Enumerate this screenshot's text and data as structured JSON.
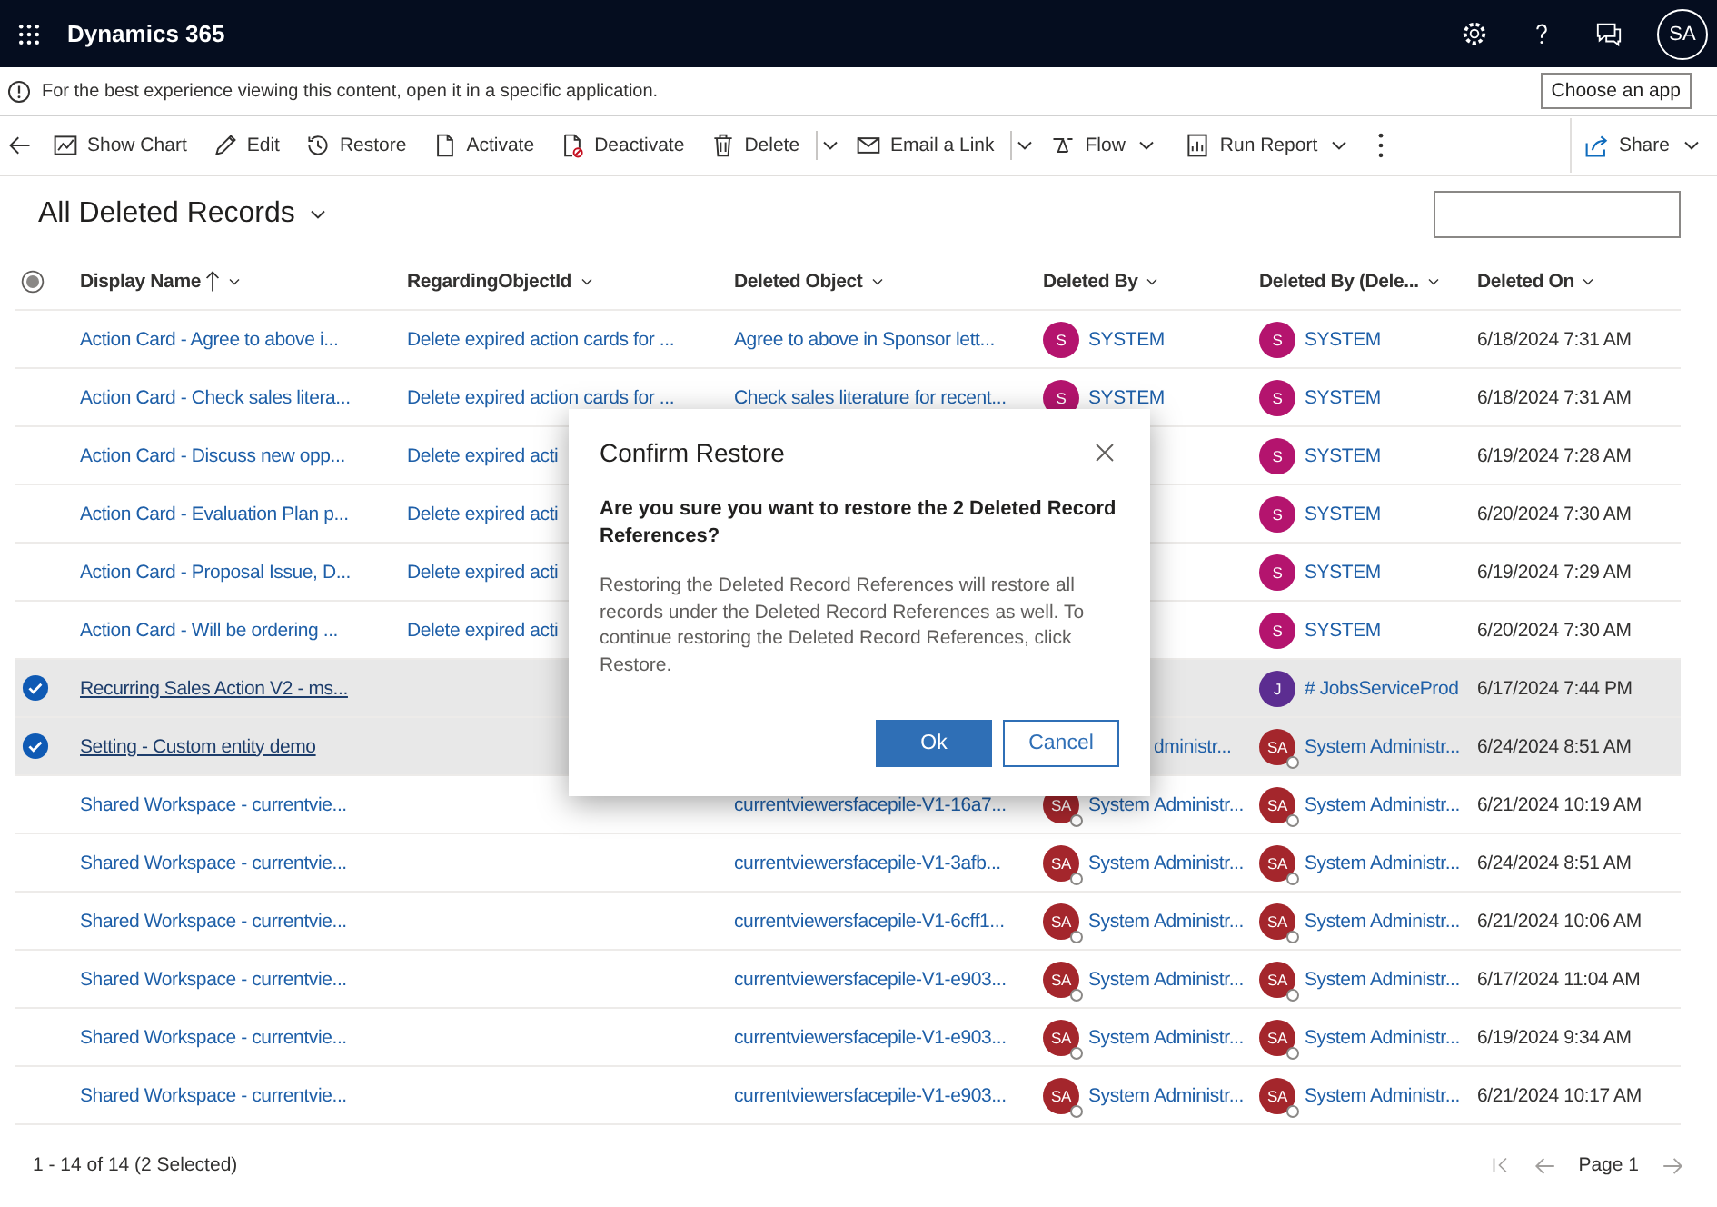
{
  "app": {
    "title": "Dynamics 365",
    "user_initials": "SA"
  },
  "notice": {
    "text": "For the best experience viewing this content, open it in a specific application.",
    "button": "Choose an app"
  },
  "commands": [
    {
      "label": "Show Chart",
      "kind": "button"
    },
    {
      "label": "Edit",
      "kind": "button"
    },
    {
      "label": "Restore",
      "kind": "button"
    },
    {
      "label": "Activate",
      "kind": "button"
    },
    {
      "label": "Deactivate",
      "kind": "button"
    },
    {
      "label": "Delete",
      "kind": "split"
    },
    {
      "label": "Email a Link",
      "kind": "split"
    },
    {
      "label": "Flow",
      "kind": "menu"
    },
    {
      "label": "Run Report",
      "kind": "menu"
    },
    {
      "kind": "overflow"
    },
    {
      "label": "Share",
      "kind": "menu"
    }
  ],
  "view": {
    "title": "All Deleted Records"
  },
  "columns": [
    {
      "label": "Display Name",
      "sorted_ascending": true
    },
    {
      "label": "RegardingObjectId",
      "sorted_ascending": false
    },
    {
      "label": "Deleted Object",
      "sorted_ascending": false
    },
    {
      "label": "Deleted By",
      "sorted_ascending": false
    },
    {
      "label": "Deleted By (Dele...",
      "sorted_ascending": false
    },
    {
      "label": "Deleted On",
      "sorted_ascending": false
    }
  ],
  "select_all": {
    "partial": true
  },
  "rows": [
    {
      "selected": false,
      "display_name": "Action Card - Agree to above i...",
      "regarding": "Delete expired action cards for ...",
      "deleted_object": "Agree to above in Sponsor lett...",
      "deleted_by": {
        "initials": "S",
        "name": "SYSTEM",
        "color": "#b4146e",
        "status_badge": false
      },
      "deleted_by_user": {
        "initials": "S",
        "name": "SYSTEM",
        "color": "#b4146e",
        "status_badge": false
      },
      "deleted_on": "6/18/2024 7:31 AM"
    },
    {
      "selected": false,
      "display_name": "Action Card - Check sales litera...",
      "regarding": "Delete expired action cards for ...",
      "deleted_object": "Check sales literature for recent...",
      "deleted_by": {
        "initials": "S",
        "name": "SYSTEM",
        "color": "#b4146e",
        "status_badge": false
      },
      "deleted_by_user": {
        "initials": "S",
        "name": "SYSTEM",
        "color": "#b4146e",
        "status_badge": false
      },
      "deleted_on": "6/18/2024 7:31 AM"
    },
    {
      "selected": false,
      "display_name": "Action Card - Discuss new opp...",
      "regarding": "Delete expired acti",
      "deleted_by_user": {
        "initials": "S",
        "name": "SYSTEM",
        "color": "#b4146e",
        "status_badge": false
      },
      "deleted_on": "6/19/2024 7:28 AM"
    },
    {
      "selected": false,
      "display_name": "Action Card - Evaluation Plan p...",
      "regarding": "Delete expired acti",
      "deleted_by_user": {
        "initials": "S",
        "name": "SYSTEM",
        "color": "#b4146e",
        "status_badge": false
      },
      "deleted_on": "6/20/2024 7:30 AM"
    },
    {
      "selected": false,
      "display_name": "Action Card - Proposal Issue, D...",
      "regarding": "Delete expired acti",
      "deleted_by_user": {
        "initials": "S",
        "name": "SYSTEM",
        "color": "#b4146e",
        "status_badge": false
      },
      "deleted_on": "6/19/2024 7:29 AM"
    },
    {
      "selected": false,
      "display_name": "Action Card - Will be ordering ...",
      "regarding": "Delete expired acti",
      "deleted_by_user": {
        "initials": "S",
        "name": "SYSTEM",
        "color": "#b4146e",
        "status_badge": false
      },
      "deleted_on": "6/20/2024 7:30 AM"
    },
    {
      "selected": true,
      "display_name": "Recurring Sales Action V2 - ms...",
      "deleted_by_user": {
        "initials": "J",
        "name": "# JobsServiceProd",
        "color": "#5c2d91",
        "status_badge": false
      },
      "deleted_on": "6/17/2024 7:44 PM"
    },
    {
      "selected": true,
      "display_name": "Setting - Custom entity demo",
      "deleted_by": {
        "name": "dministr..."
      },
      "deleted_by_user": {
        "initials": "SA",
        "name": "System Administr...",
        "color": "#a4262c",
        "status_badge": true
      },
      "deleted_on": "6/24/2024 8:51 AM"
    },
    {
      "selected": false,
      "display_name": "Shared Workspace - currentvie...",
      "deleted_object": "currentviewersfacepile-V1-16a7...",
      "deleted_by": {
        "initials": "SA",
        "name": "System Administr...",
        "color": "#a4262c",
        "status_badge": true
      },
      "deleted_by_user": {
        "initials": "SA",
        "name": "System Administr...",
        "color": "#a4262c",
        "status_badge": true
      },
      "deleted_on": "6/21/2024 10:19 AM"
    },
    {
      "selected": false,
      "display_name": "Shared Workspace - currentvie...",
      "deleted_object": "currentviewersfacepile-V1-3afb...",
      "deleted_by": {
        "initials": "SA",
        "name": "System Administr...",
        "color": "#a4262c",
        "status_badge": true
      },
      "deleted_by_user": {
        "initials": "SA",
        "name": "System Administr...",
        "color": "#a4262c",
        "status_badge": true
      },
      "deleted_on": "6/24/2024 8:51 AM"
    },
    {
      "selected": false,
      "display_name": "Shared Workspace - currentvie...",
      "deleted_object": "currentviewersfacepile-V1-6cff1...",
      "deleted_by": {
        "initials": "SA",
        "name": "System Administr...",
        "color": "#a4262c",
        "status_badge": true
      },
      "deleted_by_user": {
        "initials": "SA",
        "name": "System Administr...",
        "color": "#a4262c",
        "status_badge": true
      },
      "deleted_on": "6/21/2024 10:06 AM"
    },
    {
      "selected": false,
      "display_name": "Shared Workspace - currentvie...",
      "deleted_object": "currentviewersfacepile-V1-e903...",
      "deleted_by": {
        "initials": "SA",
        "name": "System Administr...",
        "color": "#a4262c",
        "status_badge": true
      },
      "deleted_by_user": {
        "initials": "SA",
        "name": "System Administr...",
        "color": "#a4262c",
        "status_badge": true
      },
      "deleted_on": "6/17/2024 11:04 AM"
    },
    {
      "selected": false,
      "display_name": "Shared Workspace - currentvie...",
      "deleted_object": "currentviewersfacepile-V1-e903...",
      "deleted_by": {
        "initials": "SA",
        "name": "System Administr...",
        "color": "#a4262c",
        "status_badge": true
      },
      "deleted_by_user": {
        "initials": "SA",
        "name": "System Administr...",
        "color": "#a4262c",
        "status_badge": true
      },
      "deleted_on": "6/19/2024 9:34 AM"
    },
    {
      "selected": false,
      "display_name": "Shared Workspace - currentvie...",
      "deleted_object": "currentviewersfacepile-V1-e903...",
      "deleted_by": {
        "initials": "SA",
        "name": "System Administr...",
        "color": "#a4262c",
        "status_badge": true
      },
      "deleted_by_user": {
        "initials": "SA",
        "name": "System Administr...",
        "color": "#a4262c",
        "status_badge": true
      },
      "deleted_on": "6/21/2024 10:17 AM"
    }
  ],
  "footer": {
    "count": "1 - 14 of 14 (2 Selected)",
    "page": "Page 1"
  },
  "dialog": {
    "title": "Confirm Restore",
    "question": "Are you sure you want to restore the 2 Deleted Record References?",
    "message": "Restoring the Deleted Record References will restore all records under the Deleted Record References as well. To continue restoring the Deleted Record References, click Restore.",
    "buttons": [
      {
        "label": "Ok",
        "kind": "primary"
      },
      {
        "label": "Cancel",
        "kind": "secondary"
      }
    ]
  }
}
